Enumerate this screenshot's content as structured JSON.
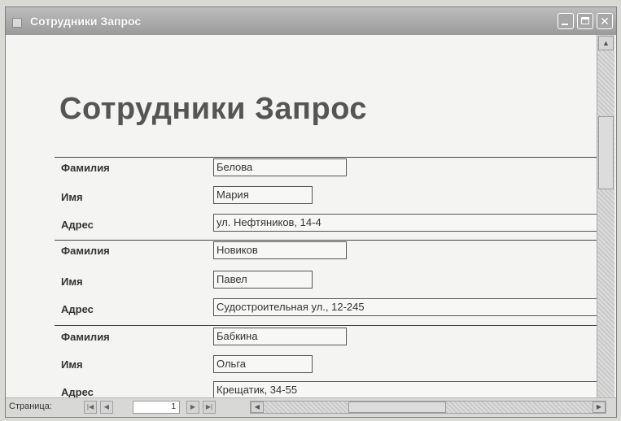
{
  "window": {
    "title": "Сотрудники Запрос"
  },
  "report": {
    "title": "Сотрудники Запрос",
    "labels": {
      "lastname": "Фамилия",
      "firstname": "Имя",
      "address": "Адрес"
    },
    "records": [
      {
        "lastname": "Белова",
        "firstname": "Мария",
        "address": "ул. Нефтяников, 14-4"
      },
      {
        "lastname": "Новиков",
        "firstname": "Павел",
        "address": "Судостроительная ул., 12-245"
      },
      {
        "lastname": "Бабкина",
        "firstname": "Ольга",
        "address": "Крещатик, 34-55"
      }
    ]
  },
  "navigation": {
    "page_label": "Страница:",
    "page_value": "1",
    "first_icon": "first-page-icon",
    "prev_icon": "previous-page-icon",
    "next_icon": "next-page-icon",
    "last_icon": "last-page-icon"
  }
}
